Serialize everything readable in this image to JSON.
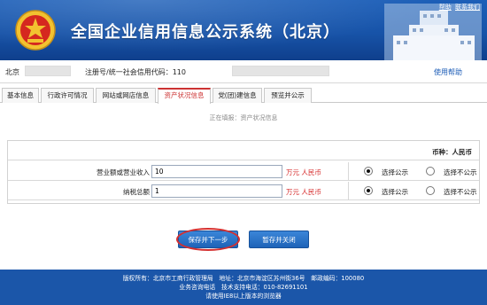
{
  "header": {
    "title": "全国企业信用信息公示系统（北京）",
    "top_links": [
      "帮助",
      "联系我们"
    ]
  },
  "infobar": {
    "city": "北京",
    "reg_label": "注册号/统一社会信用代码：110",
    "help_link": "使用帮助"
  },
  "tabs": [
    {
      "label": "基本信息",
      "active": false
    },
    {
      "label": "行政许可情况",
      "active": false
    },
    {
      "label": "网站或网店信息",
      "active": false
    },
    {
      "label": "资产状况信息",
      "active": true
    },
    {
      "label": "党(团)建信息",
      "active": false
    },
    {
      "label": "预览并公示",
      "active": false
    }
  ],
  "subtitle": "正在填报：资产状况信息",
  "form": {
    "currency_label": "币种：人民币",
    "rows": [
      {
        "label": "营业额或营业收入",
        "value": "10",
        "unit": "万元 人民币",
        "publish_label": "选择公示",
        "no_publish_label": "选择不公示",
        "publish_selected": true
      },
      {
        "label": "纳税总额",
        "value": "1",
        "unit": "万元 人民币",
        "publish_label": "选择公示",
        "no_publish_label": "选择不公示",
        "publish_selected": true
      }
    ]
  },
  "buttons": {
    "save_next": "保存并下一步",
    "save_close": "暂存并关闭"
  },
  "footer": {
    "line1": "版权所有：北京市工商行政管理局　地址：北京市海淀区苏州街36号　邮政编码：100080",
    "line2": "业务咨询电话　技术支持电话：010-82691101",
    "line3": "请使用IE8以上版本的浏览器"
  },
  "colors": {
    "header_blue": "#1753a8",
    "active_tab": "#cc3333",
    "unit_red": "#d62a2a",
    "button_blue": "#1e63b8"
  }
}
